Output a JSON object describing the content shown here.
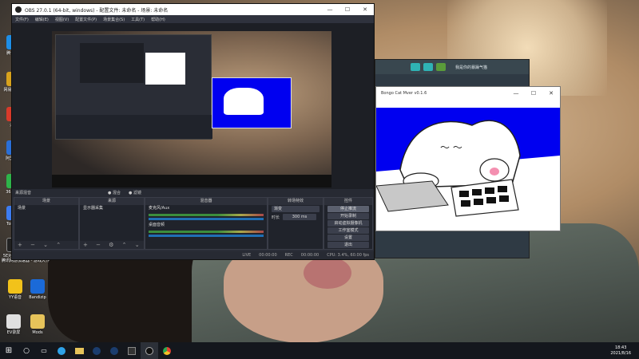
{
  "obs": {
    "title": "OBS 27.0.1 (64-bit, windows) - 配置文件: 未命名 - 场景: 未命名",
    "menu": [
      "文件(F)",
      "编辑(E)",
      "视图(V)",
      "配置文件(P)",
      "场景集合(S)",
      "工具(T)",
      "帮助(H)"
    ],
    "preview_controls": {
      "studio_mode": "● 混合",
      "record_icon": "● 滤镜"
    },
    "docks": {
      "scenes_header": "来源混音",
      "scenes_title": "场景",
      "scenes": [
        "场景"
      ],
      "sources_title": "来源",
      "sources": [
        "显示器采集"
      ],
      "mixer_title": "混音器",
      "mixer_channels": [
        {
          "label": "麦克风/Aux",
          "level": 0.7
        },
        {
          "label": "桌面音频",
          "level": 0.62
        }
      ],
      "transitions_title": "转场特效",
      "transition_selected": "渐变",
      "duration_label": "时长",
      "duration_value": "300 ms",
      "controls_title": "控件",
      "controls": [
        "停止推流",
        "开始录制",
        "启动虚拟摄像机",
        "工作室模式",
        "设置",
        "退出"
      ]
    },
    "status": {
      "live_label": "LIVE",
      "live_time": "00:00:00",
      "rec_label": "REC",
      "rec_time": "00:00:00",
      "cpu": "CPU: 3.4%, 60.00 fps"
    }
  },
  "chat_app": {
    "title": "我是你的暴躁气猫"
  },
  "cat_win": {
    "title": "Bongo Cat Mver v0.1.6"
  },
  "desktop": {
    "icons": [
      {
        "label": "腾讯QQ"
      },
      {
        "label": "网易云音乐"
      },
      {
        "label": "火绒"
      },
      {
        "label": "阿里旺旺"
      },
      {
        "label": "360安全"
      },
      {
        "label": "ToDesk"
      },
      {
        "label": "5E对战平台"
      },
      {
        "label": "腾讯视频"
      },
      {
        "label": "腾讯网游加速器 - 游戏大作"
      },
      {
        "label": "YY语音"
      },
      {
        "label": "Bandizip"
      },
      {
        "label": "EV录屏"
      },
      {
        "label": "Mods"
      }
    ]
  },
  "taskbar": {
    "time": "18:43",
    "date": "2021/8/16"
  },
  "colors": {
    "obs_bg": "#2b2e38",
    "cat_blue": "#0000f0",
    "chat_accent": "#2fb3b5"
  }
}
